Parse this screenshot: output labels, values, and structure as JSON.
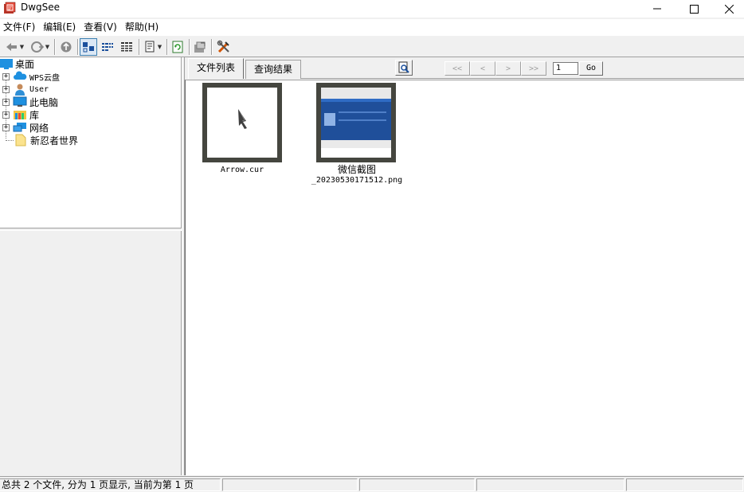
{
  "window": {
    "title": "DwgSee"
  },
  "menu": [
    {
      "label": "文件(F)"
    },
    {
      "label": "编辑(E)"
    },
    {
      "label": "查看(V)"
    },
    {
      "label": "帮助(H)"
    }
  ],
  "toolbar": {
    "buttons": [
      {
        "icon": "back-icon"
      },
      {
        "icon": "forward-icon"
      },
      {
        "icon": "up-folder-icon"
      },
      {
        "icon": "large-icons-view-icon",
        "selected": true
      },
      {
        "icon": "list-view-icon"
      },
      {
        "icon": "details-view-icon"
      },
      {
        "icon": "filter-icon"
      },
      {
        "icon": "refresh-icon"
      },
      {
        "icon": "export-icon"
      },
      {
        "icon": "tools-icon"
      }
    ]
  },
  "tree": {
    "root": {
      "label": "桌面",
      "icon": "desktop-icon"
    },
    "items": [
      {
        "label": "WPS云盘",
        "icon": "cloud-icon",
        "expandable": true
      },
      {
        "label": "User",
        "icon": "user-icon",
        "expandable": true
      },
      {
        "label": "此电脑",
        "icon": "computer-icon",
        "expandable": true
      },
      {
        "label": "库",
        "icon": "library-icon",
        "expandable": true
      },
      {
        "label": "网络",
        "icon": "network-icon",
        "expandable": true
      },
      {
        "label": "新忍者世界",
        "icon": "folder-icon",
        "expandable": false
      }
    ]
  },
  "tabs": [
    {
      "label": "文件列表",
      "active": true
    },
    {
      "label": "查询结果",
      "active": false
    }
  ],
  "pager": {
    "first": "<<",
    "prev": "<",
    "next": ">",
    "last": ">>",
    "page_value": "1",
    "go_label": "Go"
  },
  "files": [
    {
      "name_line1": "Arrow.cur",
      "name_line2": ""
    },
    {
      "name_line1": "微信截图",
      "name_line2": "_20230530171512.png"
    }
  ],
  "status": {
    "text": "总共 2 个文件, 分为 1 页显示, 当前为第 1 页"
  },
  "colors": {
    "thumb_frame": "#45463f",
    "selection": "#dbe8f5",
    "desktop_blue": "#1e90e0"
  }
}
